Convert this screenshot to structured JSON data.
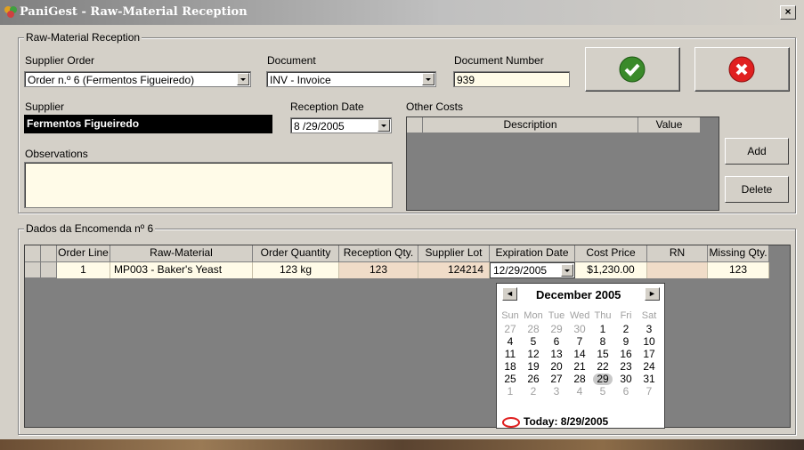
{
  "window": {
    "title": "PaniGest - Raw-Material Reception",
    "close": "×"
  },
  "reception": {
    "group_label": "Raw-Material Reception",
    "supplier_order_label": "Supplier Order",
    "supplier_order_value": "Order n.º 6 (Fermentos Figueiredo)",
    "document_label": "Document",
    "document_value": "INV - Invoice",
    "document_number_label": "Document Number",
    "document_number_value": "939",
    "supplier_label": "Supplier",
    "supplier_value": "Fermentos Figueiredo",
    "reception_date_label": "Reception Date",
    "reception_date_value": "8 /29/2005",
    "other_costs_label": "Other Costs",
    "other_costs_columns": [
      "Description",
      "Value"
    ],
    "observations_label": "Observations",
    "observations_value": "",
    "add_label": "Add",
    "delete_label": "Delete"
  },
  "order_grid": {
    "group_label": "Dados da Encomenda nº 6",
    "columns": [
      "Order Line",
      "Raw-Material",
      "Order Quantity",
      "Reception Qty.",
      "Supplier Lot",
      "Expiration Date",
      "Cost Price",
      "RN",
      "Missing Qty."
    ],
    "rows": [
      {
        "order_line": "1",
        "raw_material": "MP003 - Baker's Yeast",
        "order_quantity": "123 kg",
        "reception_qty": "123",
        "supplier_lot": "124214",
        "expiration_date": "12/29/2005",
        "cost_price": "$1,230.00",
        "rn": "",
        "missing_qty": "123"
      }
    ]
  },
  "calendar": {
    "month": "December 2005",
    "prev": "◄",
    "next": "►",
    "weekdays": [
      "Sun",
      "Mon",
      "Tue",
      "Wed",
      "Thu",
      "Fri",
      "Sat"
    ],
    "weeks": [
      [
        "27",
        "28",
        "29",
        "30",
        "1",
        "2",
        "3"
      ],
      [
        "4",
        "5",
        "6",
        "7",
        "8",
        "9",
        "10"
      ],
      [
        "11",
        "12",
        "13",
        "14",
        "15",
        "16",
        "17"
      ],
      [
        "18",
        "19",
        "20",
        "21",
        "22",
        "23",
        "24"
      ],
      [
        "25",
        "26",
        "27",
        "28",
        "29",
        "30",
        "31"
      ],
      [
        "1",
        "2",
        "3",
        "4",
        "5",
        "6",
        "7"
      ]
    ],
    "today": "Today: 8/29/2005"
  },
  "colors": {
    "accept": "#3a8a2a",
    "cancel": "#e02020",
    "highlight_cell": "#f0dcc8",
    "row_bg": "#fffbe8"
  }
}
